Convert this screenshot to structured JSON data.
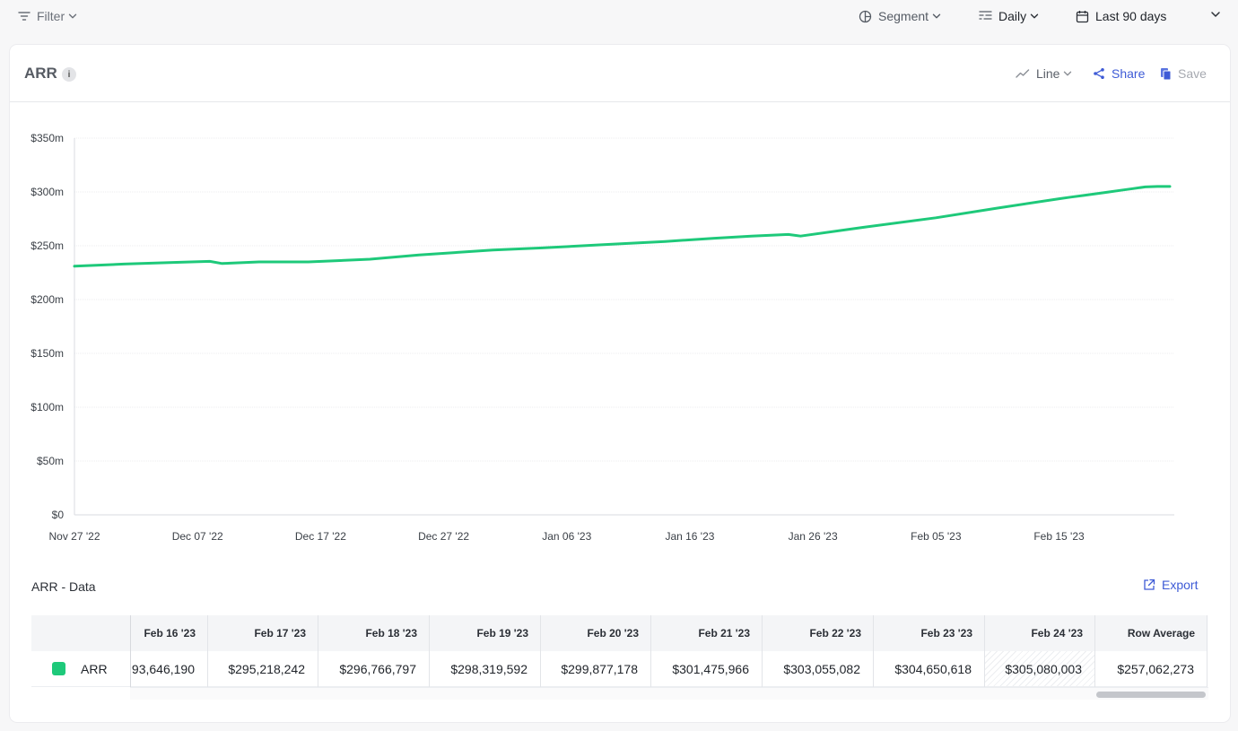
{
  "toolbar": {
    "filter_label": "Filter",
    "segment_label": "Segment",
    "interval_label": "Daily",
    "range_label": "Last 90 days"
  },
  "card": {
    "title": "ARR",
    "info_glyph": "i",
    "chart_type_label": "Line",
    "share_label": "Share",
    "save_label": "Save"
  },
  "colors": {
    "series": "#1ec97a",
    "accent": "#3e5bd6"
  },
  "icons": {
    "filter": "filter-icon",
    "segment": "segment-icon",
    "interval": "interval-icon",
    "calendar": "calendar-icon",
    "line": "line-chart-icon",
    "share": "share-icon",
    "save": "save-icon",
    "export": "export-icon"
  },
  "chart_data": {
    "type": "line",
    "ylim": [
      0,
      350000000
    ],
    "y_ticks": [
      0,
      50000000,
      100000000,
      150000000,
      200000000,
      250000000,
      300000000,
      350000000
    ],
    "y_tick_labels": [
      "$0",
      "$50m",
      "$100m",
      "$150m",
      "$200m",
      "$250m",
      "$300m",
      "$350m"
    ],
    "x_start": "2022-11-27",
    "x_end": "2023-02-24",
    "x_ticks": [
      "2022-11-27",
      "2022-12-07",
      "2022-12-17",
      "2022-12-27",
      "2023-01-06",
      "2023-01-16",
      "2023-01-26",
      "2023-02-05",
      "2023-02-15"
    ],
    "x_tick_labels": [
      "Nov 27 '22",
      "Dec 07 '22",
      "Dec 17 '22",
      "Dec 27 '22",
      "Jan 06 '23",
      "Jan 16 '23",
      "Jan 26 '23",
      "Feb 05 '23",
      "Feb 15 '23"
    ],
    "grid": true,
    "series": [
      {
        "color": "#1ec97a",
        "x": [
          "2022-11-27",
          "2022-12-01",
          "2022-12-05",
          "2022-12-08",
          "2022-12-09",
          "2022-12-12",
          "2022-12-16",
          "2022-12-21",
          "2022-12-25",
          "2022-12-31",
          "2023-01-04",
          "2023-01-09",
          "2023-01-14",
          "2023-01-18",
          "2023-01-21",
          "2023-01-24",
          "2023-01-25",
          "2023-01-30",
          "2023-02-05",
          "2023-02-10",
          "2023-02-15",
          "2023-02-16",
          "2023-02-17",
          "2023-02-18",
          "2023-02-19",
          "2023-02-20",
          "2023-02-21",
          "2023-02-22",
          "2023-02-23",
          "2023-02-24"
        ],
        "y": [
          231000000,
          233000000,
          234500000,
          235500000,
          233500000,
          235000000,
          235000000,
          237500000,
          241500000,
          246000000,
          248000000,
          251000000,
          254000000,
          257000000,
          259000000,
          260500000,
          259000000,
          267000000,
          276000000,
          285000000,
          293646190,
          295218242,
          296766797,
          298319592,
          299877178,
          301475966,
          303055082,
          304650618,
          305080003,
          305080003
        ]
      }
    ]
  },
  "data_section": {
    "title": "ARR - Data",
    "export_label": "Export",
    "series_name": "ARR",
    "columns": [
      {
        "header": "Feb 16 '23",
        "value": "93,646,190",
        "hatched": false
      },
      {
        "header": "Feb 17 '23",
        "value": "$295,218,242",
        "hatched": false
      },
      {
        "header": "Feb 18 '23",
        "value": "$296,766,797",
        "hatched": false
      },
      {
        "header": "Feb 19 '23",
        "value": "$298,319,592",
        "hatched": false
      },
      {
        "header": "Feb 20 '23",
        "value": "$299,877,178",
        "hatched": false
      },
      {
        "header": "Feb 21 '23",
        "value": "$301,475,966",
        "hatched": false
      },
      {
        "header": "Feb 22 '23",
        "value": "$303,055,082",
        "hatched": false
      },
      {
        "header": "Feb 23 '23",
        "value": "$304,650,618",
        "hatched": false
      },
      {
        "header": "Feb 24 '23",
        "value": "$305,080,003",
        "hatched": true
      },
      {
        "header": "Row Average",
        "value": "$257,062,273",
        "hatched": false
      }
    ]
  }
}
